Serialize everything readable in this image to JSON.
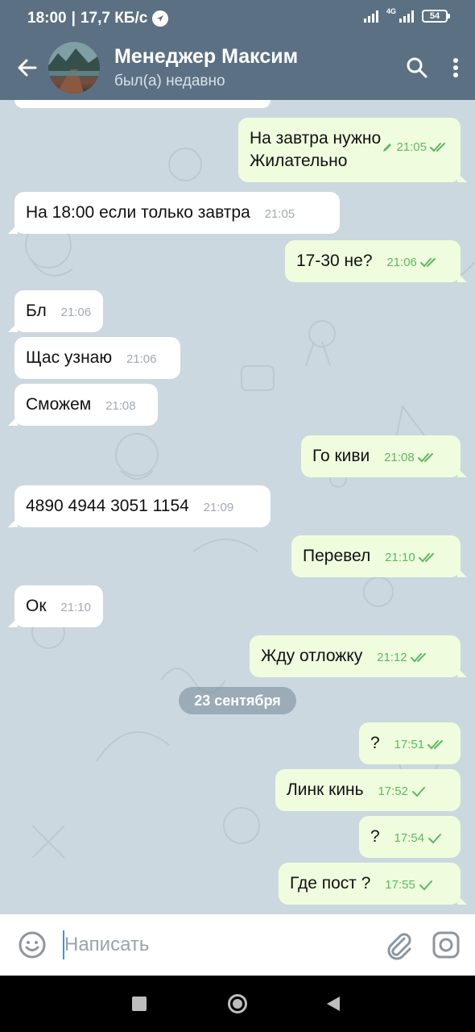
{
  "status_bar": {
    "time": "18:00",
    "speed": "17,7 КБ/с",
    "network": "4G",
    "battery": "54"
  },
  "header": {
    "title": "Менеджер Максим",
    "subtitle": "был(а) недавно"
  },
  "messages": [
    {
      "dir": "out",
      "text": "На завтра нужно\nЖилательно",
      "time": "21:05",
      "edited": true,
      "status": "read"
    },
    {
      "dir": "in",
      "text": "На 18:00 если только завтра",
      "time": "21:05"
    },
    {
      "dir": "out",
      "text": "17-30 не?",
      "time": "21:06",
      "status": "read"
    },
    {
      "dir": "in",
      "text": "Бл",
      "time": "21:06"
    },
    {
      "dir": "in",
      "text": "Щас узнаю",
      "time": "21:06"
    },
    {
      "dir": "in",
      "text": "Сможем",
      "time": "21:08"
    },
    {
      "dir": "out",
      "text": "Го киви",
      "time": "21:08",
      "status": "read"
    },
    {
      "dir": "in",
      "text": "4890 4944 3051 1154",
      "time": "21:09"
    },
    {
      "dir": "out",
      "text": "Перевел",
      "time": "21:10",
      "status": "read"
    },
    {
      "dir": "in",
      "text": "Ок",
      "time": "21:10"
    },
    {
      "dir": "out",
      "text": "Жду отложку",
      "time": "21:12",
      "status": "read"
    },
    {
      "dir": "out",
      "text": "?",
      "time": "17:51",
      "status": "read"
    },
    {
      "dir": "out",
      "text": "Линк кинь",
      "time": "17:52",
      "status": "sent"
    },
    {
      "dir": "out",
      "text": "?",
      "time": "17:54",
      "status": "sent"
    },
    {
      "dir": "out",
      "text": "Где пост ?",
      "time": "17:55",
      "status": "sent"
    }
  ],
  "date_separator": "23 сентября",
  "input": {
    "placeholder": "Написать"
  },
  "colors": {
    "header": "#5b7183",
    "chat_bg": "#ccd8df",
    "outgoing_bubble": "#effdde",
    "incoming_bubble": "#ffffff",
    "check_green": "#5cb862"
  },
  "icons": {
    "back": "arrow-left-icon",
    "search": "search-icon",
    "menu": "more-vertical-icon",
    "emoji": "emoji-icon",
    "attach": "paperclip-icon",
    "camera": "camera-icon"
  }
}
